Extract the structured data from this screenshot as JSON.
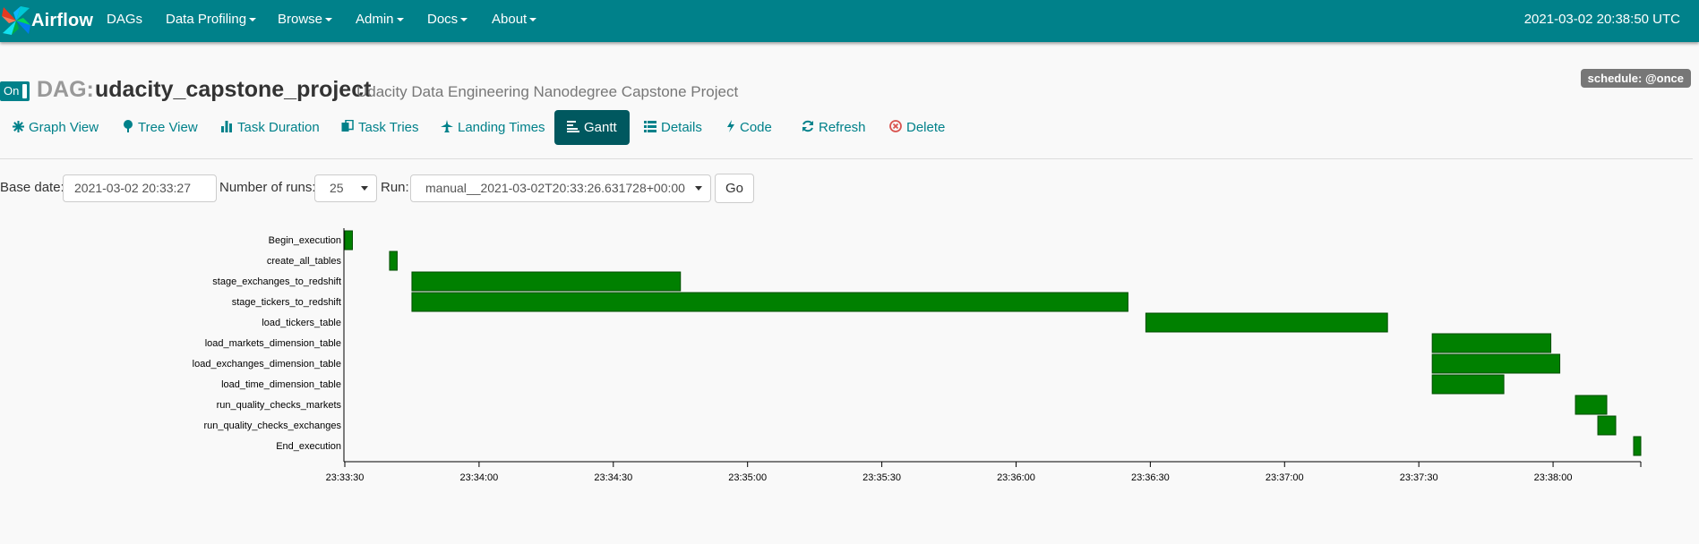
{
  "navbar": {
    "brand": "Airflow",
    "items": [
      {
        "label": "DAGs",
        "dropdown": false
      },
      {
        "label": "Data Profiling",
        "dropdown": true
      },
      {
        "label": "Browse",
        "dropdown": true
      },
      {
        "label": "Admin",
        "dropdown": true
      },
      {
        "label": "Docs",
        "dropdown": true
      },
      {
        "label": "About",
        "dropdown": true
      }
    ],
    "clock": "2021-03-02 20:38:50 UTC"
  },
  "dag": {
    "toggle_label": "On",
    "prefix": "DAG:",
    "id": "udacity_capstone_project",
    "description": "Udacity Data Engineering Nanodegree Capstone Project",
    "schedule": "schedule: @once"
  },
  "tabs": [
    {
      "label": "Graph View",
      "icon": "asterisk-icon"
    },
    {
      "label": "Tree View",
      "icon": "tree-icon"
    },
    {
      "label": "Task Duration",
      "icon": "bar-chart-icon"
    },
    {
      "label": "Task Tries",
      "icon": "duplicate-icon"
    },
    {
      "label": "Landing Times",
      "icon": "plane-icon"
    },
    {
      "label": "Gantt",
      "icon": "gantt-icon",
      "active": true
    },
    {
      "label": "Details",
      "icon": "list-icon"
    },
    {
      "label": "Code",
      "icon": "flash-icon"
    },
    {
      "label": "Refresh",
      "icon": "refresh-icon"
    },
    {
      "label": "Delete",
      "icon": "delete-icon"
    }
  ],
  "form": {
    "base_date_label": "Base date:",
    "base_date_value": "2021-03-02 20:33:27",
    "num_runs_label": "Number of runs:",
    "num_runs_value": "25",
    "run_label": "Run:",
    "run_value": "manual__2021-03-02T20:33:26.631728+00:00",
    "go_label": "Go"
  },
  "colors": {
    "navbar": "#00818a",
    "accent": "#00818a",
    "task_success": "#008000"
  },
  "chart_data": {
    "type": "gantt",
    "tasks": [
      {
        "name": "Begin_execution",
        "start": "23:33:30.0",
        "end": "23:33:31.7"
      },
      {
        "name": "create_all_tables",
        "start": "23:33:40.0",
        "end": "23:33:41.7"
      },
      {
        "name": "stage_exchanges_to_redshift",
        "start": "23:33:45.0",
        "end": "23:34:45.0"
      },
      {
        "name": "stage_tickers_to_redshift",
        "start": "23:33:45.0",
        "end": "23:36:25.0"
      },
      {
        "name": "load_tickers_table",
        "start": "23:36:29.0",
        "end": "23:37:23.0"
      },
      {
        "name": "load_markets_dimension_table",
        "start": "23:37:33.0",
        "end": "23:37:59.5"
      },
      {
        "name": "load_exchanges_dimension_table",
        "start": "23:37:33.0",
        "end": "23:38:01.5"
      },
      {
        "name": "load_time_dimension_table",
        "start": "23:37:33.0",
        "end": "23:37:49.0"
      },
      {
        "name": "run_quality_checks_markets",
        "start": "23:38:05.0",
        "end": "23:38:12.0"
      },
      {
        "name": "run_quality_checks_exchanges",
        "start": "23:38:10.0",
        "end": "23:38:14.0"
      },
      {
        "name": "End_execution",
        "start": "23:38:18.0",
        "end": "23:38:19.5"
      }
    ],
    "x_ticks": [
      "23:33:30",
      "23:34:00",
      "23:34:30",
      "23:35:00",
      "23:35:30",
      "23:36:00",
      "23:36:30",
      "23:37:00",
      "23:37:30",
      "23:38:00"
    ],
    "x_range": [
      "23:33:30",
      "23:38:19"
    ],
    "status": "success"
  }
}
